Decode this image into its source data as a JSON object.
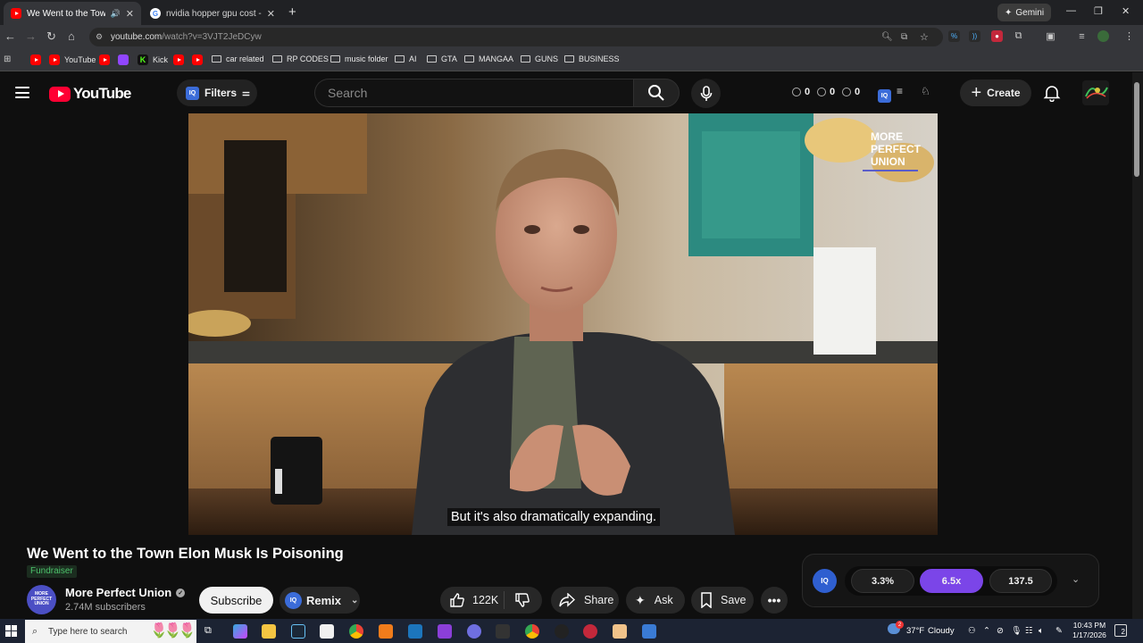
{
  "browser": {
    "tabs": [
      {
        "title": "We Went to the Town Elon",
        "active": true,
        "favicon": "youtube-favicon",
        "audio": true
      },
      {
        "title": "nvidia hopper gpu cost - Goog",
        "active": false,
        "favicon": "google-favicon"
      }
    ],
    "gemini_label": "Gemini",
    "url_host": "youtube.com",
    "url_path": "/watch?v=3VJT2JeDCyw",
    "bookmarks": [
      {
        "label": "YouTube",
        "type": "site"
      },
      {
        "label": "Kick",
        "type": "site"
      },
      {
        "label": "car related",
        "type": "folder"
      },
      {
        "label": "RP CODES",
        "type": "folder"
      },
      {
        "label": "music folder",
        "type": "folder"
      },
      {
        "label": "AI",
        "type": "folder"
      },
      {
        "label": "GTA",
        "type": "folder"
      },
      {
        "label": "MANGAA",
        "type": "folder"
      },
      {
        "label": "GUNS",
        "type": "folder"
      },
      {
        "label": "BUSINESS",
        "type": "folder"
      }
    ]
  },
  "youtube": {
    "logo_text": "YouTube",
    "filters_label": "Filters",
    "search_placeholder": "Search",
    "counters": [
      "0",
      "0",
      "0"
    ],
    "create_label": "Create"
  },
  "video": {
    "caption": "But it's also dramatically expanding.",
    "watermark": [
      "MORE",
      "PERFECT",
      "UNION"
    ],
    "title": "We Went to the Town Elon Musk Is Poisoning",
    "fundraiser_label": "Fundraiser",
    "channel_name": "More Perfect Union",
    "channel_avatar_text": [
      "MORE",
      "PERFECT",
      "UNION"
    ],
    "subscribers": "2.74M subscribers",
    "subscribe_label": "Subscribe",
    "remix_label": "Remix",
    "likes": "122K",
    "share_label": "Share",
    "ask_label": "Ask",
    "save_label": "Save"
  },
  "iq_panel": {
    "stats": [
      "3.3%",
      "6.5x",
      "137.5"
    ],
    "highlight_color": "#7b45e8"
  },
  "taskbar": {
    "search_placeholder": "Type here to search",
    "weather_temp": "37°F",
    "weather_desc": "Cloudy",
    "time": "10:43 PM",
    "date": "1/17/2026",
    "notification_count": "2"
  },
  "colors": {
    "youtube_red": "#ff0033",
    "accent_purple": "#7b45e8",
    "iq_blue": "#3b6cd9",
    "fundraiser_green": "#4cc26b"
  }
}
